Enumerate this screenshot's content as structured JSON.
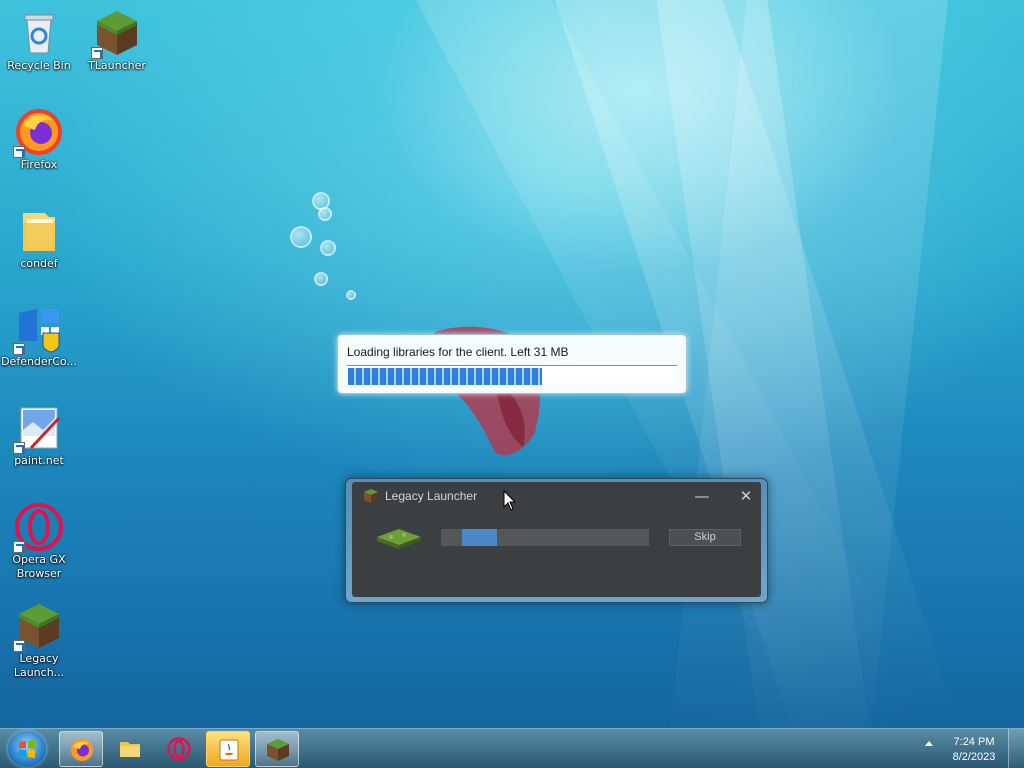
{
  "desktop_icons": [
    {
      "label": "Recycle Bin",
      "icon": "recycle-bin-icon"
    },
    {
      "label": "TLauncher",
      "icon": "minecraft-grass-block-icon"
    },
    {
      "label": "Firefox",
      "icon": "firefox-icon"
    },
    {
      "label": "condef",
      "icon": "folder-icon"
    },
    {
      "label": "DefenderCo...",
      "icon": "windows-defender-icon"
    },
    {
      "label": "paint.net",
      "icon": "paint-net-icon"
    },
    {
      "label": "Opera GX Browser",
      "icon": "opera-gx-icon"
    },
    {
      "label": "Legacy Launch...",
      "icon": "minecraft-grass-block-icon"
    }
  ],
  "loader": {
    "message": "Loading libraries for the client. Left 31 MB",
    "progress_fraction": 0.59
  },
  "launcher_window": {
    "title": "Legacy Launcher",
    "minimize_glyph": "—",
    "close_glyph": "✕",
    "skip_label": "Skip",
    "progress_segment_start": 0.1,
    "progress_segment_end": 0.27
  },
  "taskbar": {
    "items": [
      {
        "name": "firefox",
        "icon": "firefox-icon",
        "active": true
      },
      {
        "name": "file-explorer",
        "icon": "folder-icon",
        "active": false
      },
      {
        "name": "opera-gx",
        "icon": "opera-gx-icon",
        "active": false
      },
      {
        "name": "java",
        "icon": "java-icon",
        "active": true
      },
      {
        "name": "legacy-launcher",
        "icon": "minecraft-grass-block-icon",
        "active": true
      }
    ],
    "clock_time": "7:24 PM",
    "clock_date": "8/2/2023"
  },
  "colors": {
    "accent": "#2d7fdb",
    "launcher_bg": "#3c3f41"
  }
}
